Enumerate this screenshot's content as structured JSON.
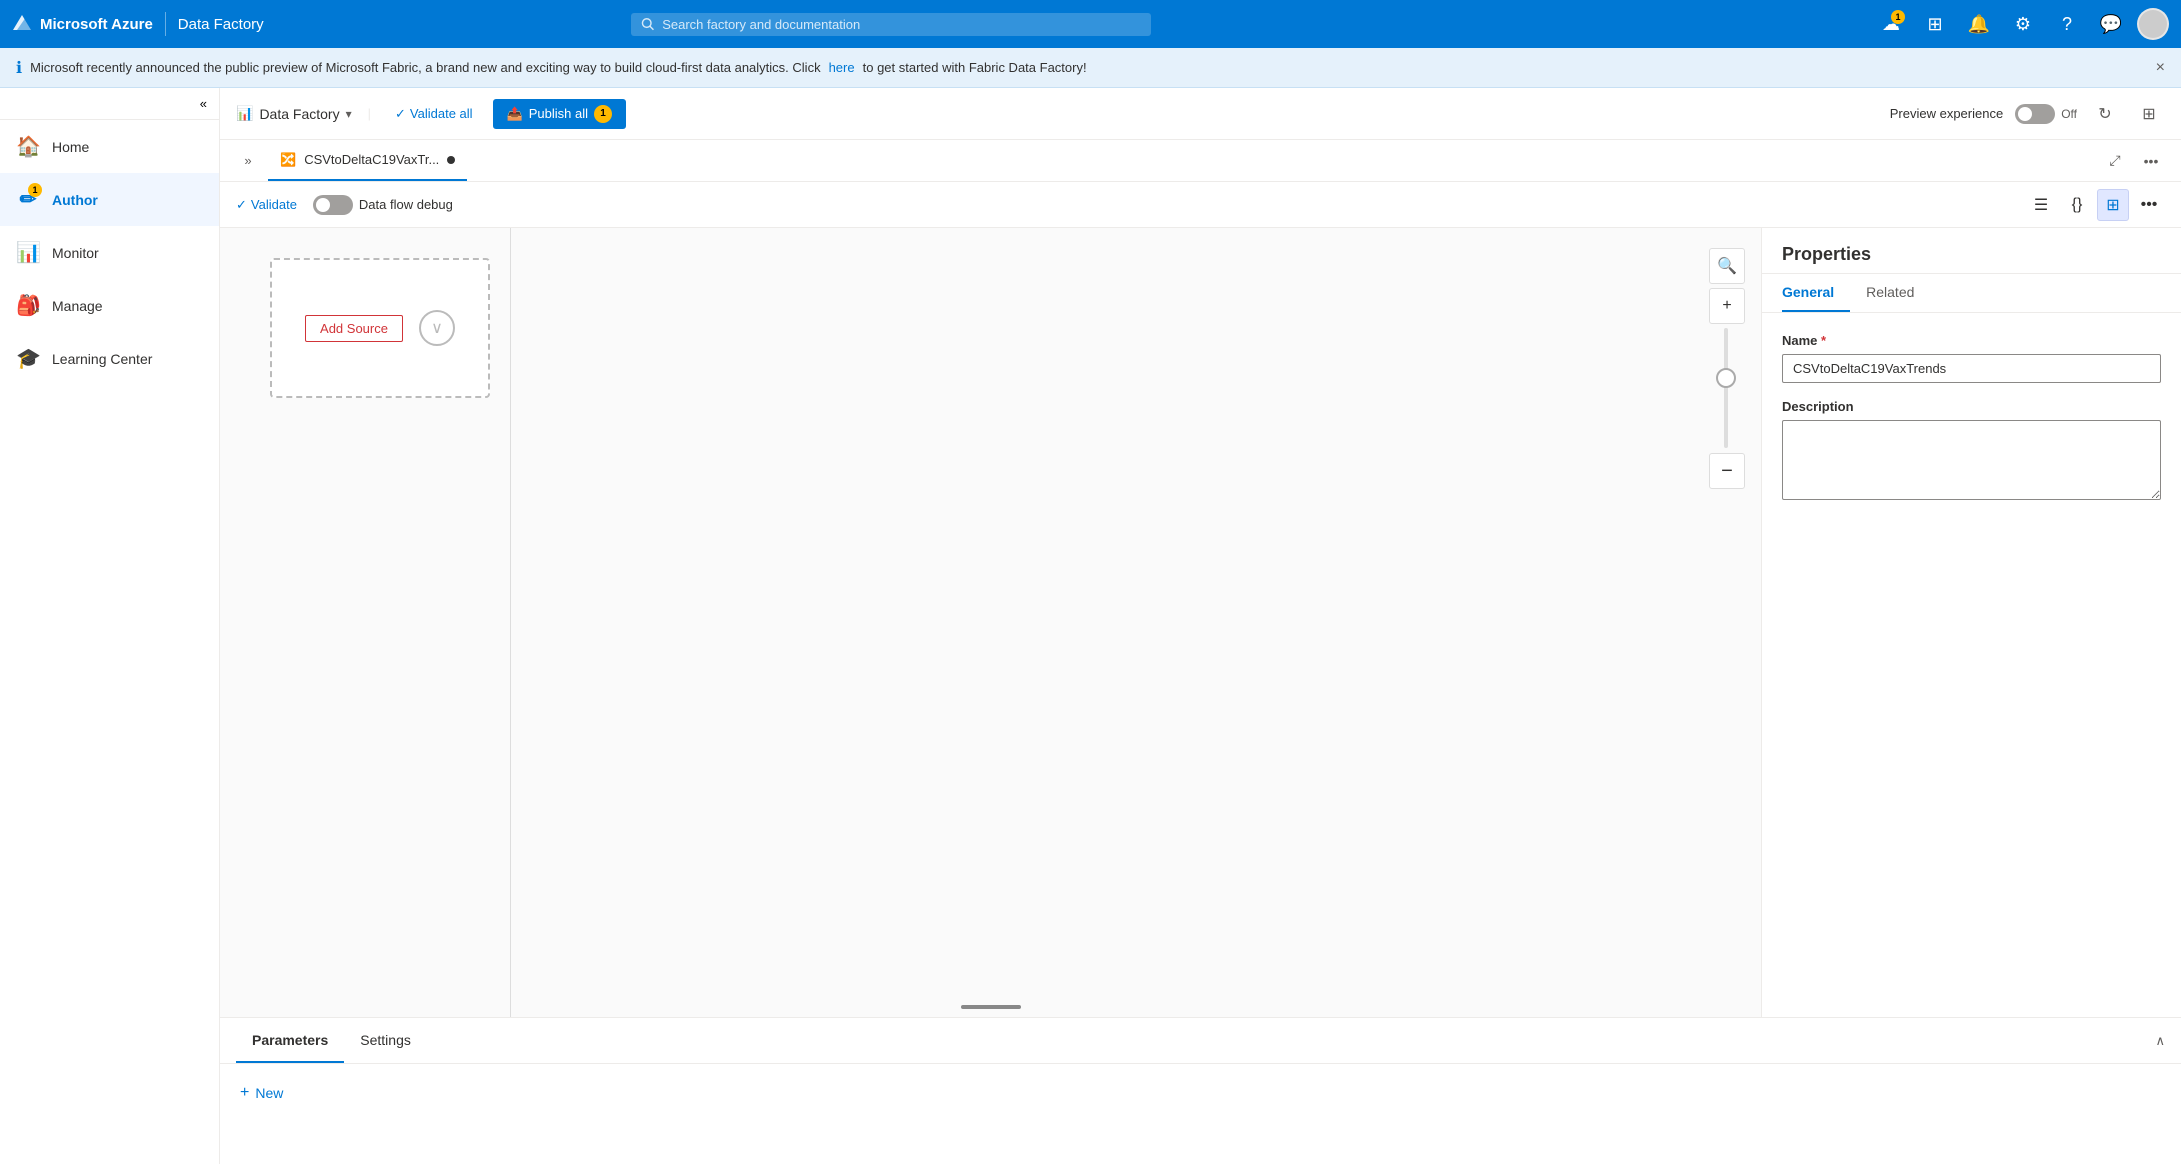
{
  "topnav": {
    "brand": "Microsoft Azure",
    "app_name": "Data Factory",
    "search_placeholder": "Search factory and documentation",
    "notifications_count": "1",
    "icons": {
      "cloud": "☁",
      "grid": "⊞",
      "bell": "🔔",
      "gear": "⚙",
      "help": "?",
      "feedback": "💬"
    }
  },
  "banner": {
    "text": "Microsoft recently announced the public preview of Microsoft Fabric, a brand new and exciting way to build cloud-first data analytics. Click ",
    "link_text": "here",
    "text_after": " to get started with Fabric Data Factory!",
    "close": "×"
  },
  "sidebar": {
    "collapse_icon": "«",
    "items": [
      {
        "id": "home",
        "label": "Home",
        "icon": "🏠",
        "active": false
      },
      {
        "id": "author",
        "label": "Author",
        "icon": "✏",
        "active": true,
        "badge": "1"
      },
      {
        "id": "monitor",
        "label": "Monitor",
        "icon": "📊",
        "active": false
      },
      {
        "id": "manage",
        "label": "Manage",
        "icon": "🎒",
        "active": false
      },
      {
        "id": "learning",
        "label": "Learning Center",
        "icon": "🎓",
        "active": false
      }
    ]
  },
  "toolbar": {
    "brand_icon": "📊",
    "brand_label": "Data Factory",
    "chevron": "▾",
    "validate_label": "Validate all",
    "validate_icon": "✓",
    "publish_label": "Publish all",
    "publish_icon": "📤",
    "publish_count": "1",
    "preview_label": "Preview experience",
    "toggle_off": "Off",
    "refresh_icon": "↻",
    "settings_icon": "⊞"
  },
  "tab": {
    "icon": "🔀",
    "label": "CSVtoDeltaC19VaxTr...",
    "dot": true,
    "expand_icon": "⤢",
    "more_icon": "•••"
  },
  "subtoolbar": {
    "validate_icon": "✓",
    "validate_label": "Validate",
    "debug_label": "Data flow debug",
    "tools": [
      {
        "id": "list-view",
        "icon": "≡",
        "active": false
      },
      {
        "id": "code-view",
        "icon": "{}",
        "active": false
      },
      {
        "id": "visual-view",
        "icon": "⊞",
        "active": true
      },
      {
        "id": "more",
        "icon": "•••",
        "active": false
      }
    ]
  },
  "canvas": {
    "add_source_label": "Add Source",
    "zoom_in_icon": "+",
    "zoom_out_icon": "−",
    "search_icon": "🔍"
  },
  "properties": {
    "title": "Properties",
    "tabs": [
      {
        "id": "general",
        "label": "General",
        "active": true
      },
      {
        "id": "related",
        "label": "Related",
        "active": false
      }
    ],
    "name_label": "Name",
    "name_required": "*",
    "name_value": "CSVtoDeltaC19VaxTrends",
    "description_label": "Description",
    "description_value": ""
  },
  "bottom": {
    "tabs": [
      {
        "id": "parameters",
        "label": "Parameters",
        "active": true
      },
      {
        "id": "settings",
        "label": "Settings",
        "active": false
      }
    ],
    "collapse_icon": "∧",
    "new_button_label": "New",
    "new_button_icon": "+"
  }
}
